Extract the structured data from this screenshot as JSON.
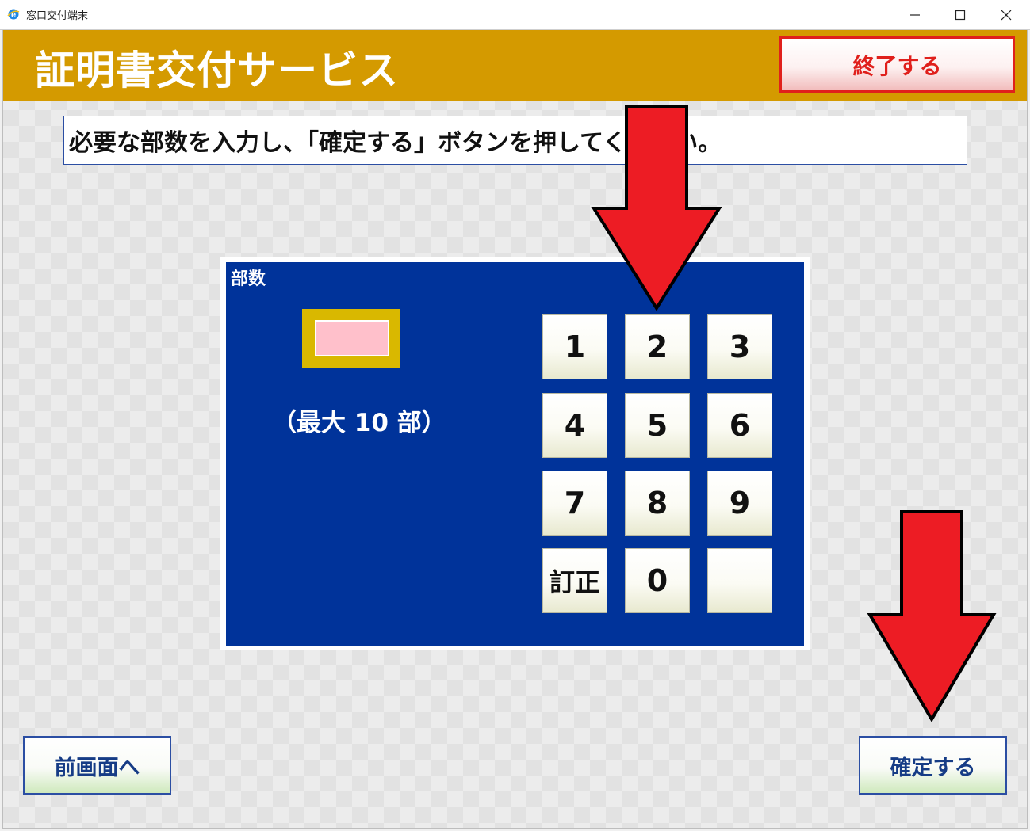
{
  "window": {
    "title": "窓口交付端末",
    "icons": {
      "app": "ie-icon",
      "minimize": "minimize-icon",
      "maximize": "maximize-icon",
      "close": "close-icon"
    }
  },
  "header": {
    "title": "証明書交付サービス",
    "end_label": "終了する",
    "background_color": "#d49a00",
    "end_color": "#e0201c"
  },
  "instruction": {
    "text": "必要な部数を入力し、「確定する」ボタンを押してください。"
  },
  "panel": {
    "label": "部数",
    "count_value": "",
    "max_note": "（最大 10 部）",
    "background_color": "#00339a",
    "input_color": "#ffc0cb"
  },
  "keypad": {
    "keys": [
      "1",
      "2",
      "3",
      "4",
      "5",
      "6",
      "7",
      "8",
      "9",
      "訂正",
      "0",
      ""
    ]
  },
  "footer": {
    "back_label": "前画面へ",
    "confirm_label": "確定する"
  },
  "annotations": {
    "arrow_color": "#ed1c24",
    "arrow_targets": [
      "keypad-key-2",
      "confirm-button"
    ]
  }
}
